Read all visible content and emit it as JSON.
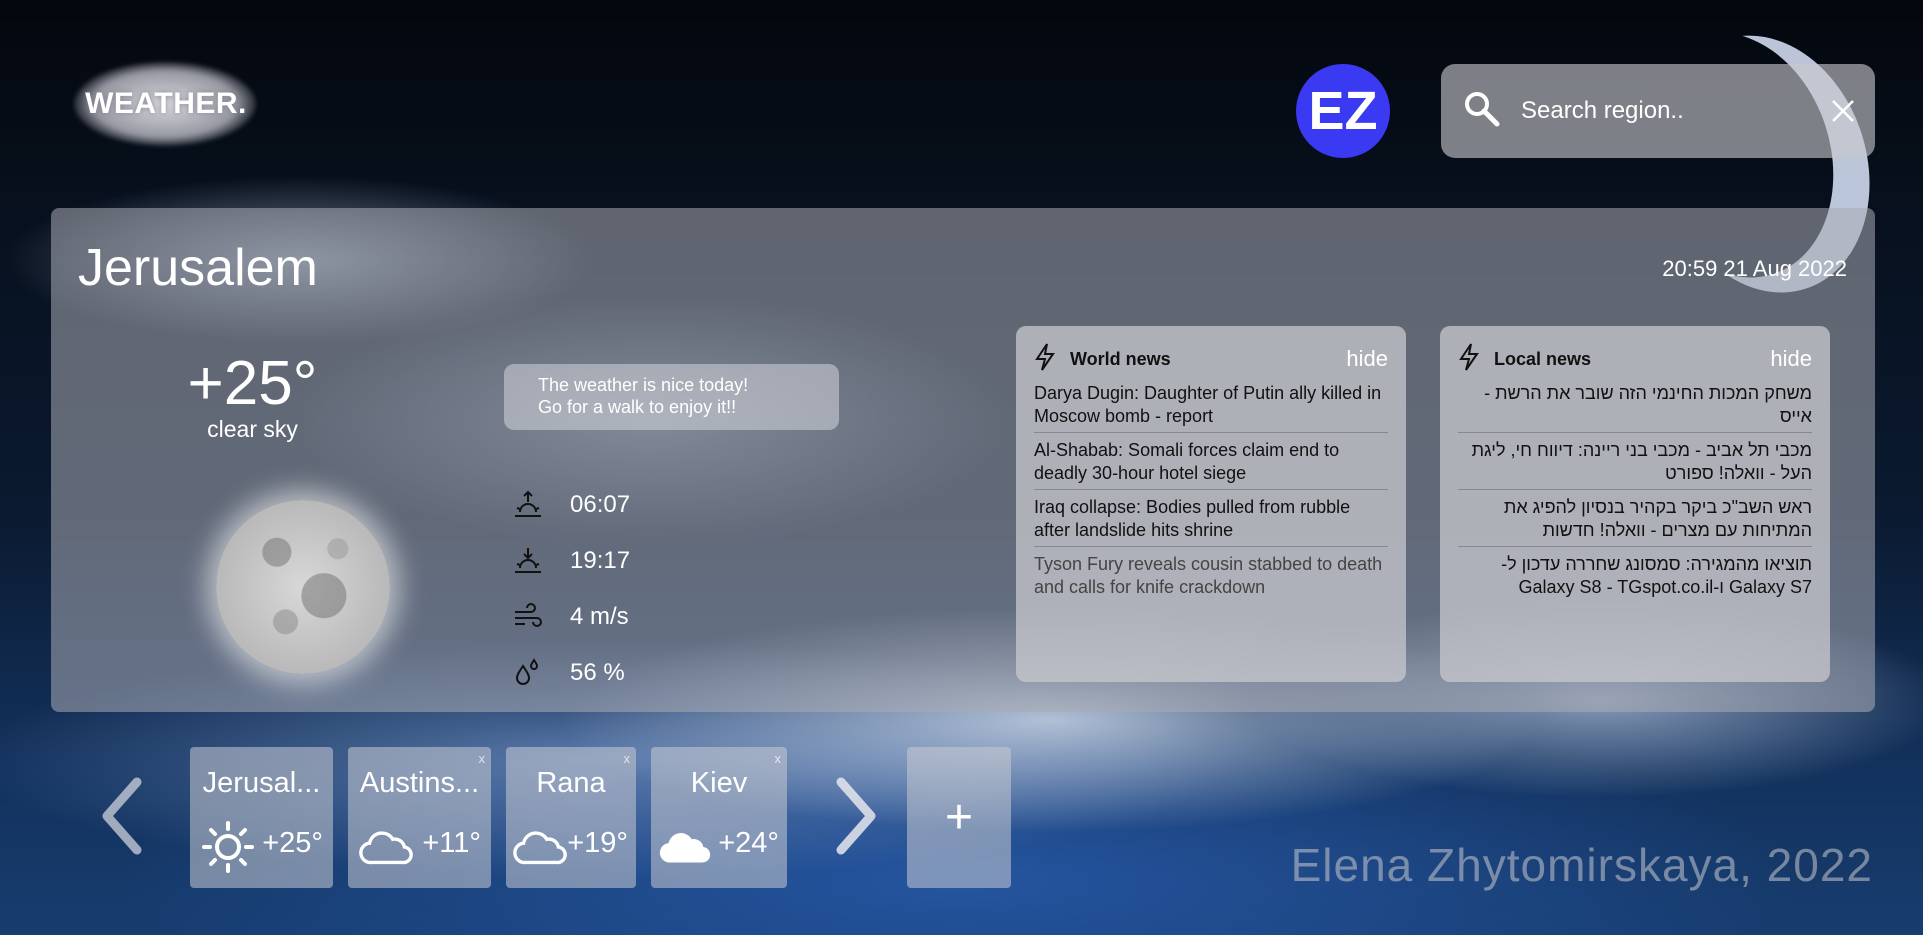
{
  "logo": {
    "text": "WEATHER."
  },
  "user": {
    "initials": "EZ",
    "avatar_color": "#3a3af2"
  },
  "search": {
    "placeholder": "Search region.."
  },
  "current": {
    "city": "Jerusalem",
    "datetime": "20:59 21 Aug 2022",
    "temperature": "+25°",
    "description": "clear sky",
    "tip_line1": "The weather is nice today!",
    "tip_line2": "Go for a walk to enjoy it!!",
    "sunrise": "06:07",
    "sunset": "19:17",
    "wind": "4 m/s",
    "humidity": "56 %"
  },
  "world_news": {
    "title": "World news",
    "hide_label": "hide",
    "items": [
      "Darya Dugin: Daughter of Putin ally killed in Moscow bomb - report",
      "Al-Shabab: Somali forces claim end to deadly 30-hour hotel siege",
      "Iraq collapse: Bodies pulled from rubble after landslide hits shrine",
      "Tyson Fury reveals cousin stabbed to death and calls for knife crackdown"
    ]
  },
  "local_news": {
    "title": "Local news",
    "hide_label": "hide",
    "items": [
      "משחק המכות החינמי הזה שובר את הרשת - אייס",
      "מכבי תל אביב - מכבי בני ריינה: דיווח חי, ליגת העל - וואלה! ספורט",
      "ראש השב\"כ ביקר בקהיר בנסיון להפיג את המתיחות עם מצרים - וואלה! חדשות",
      "תוציאו מהמגירה: סמסונג שחררה עדכון ל-Galaxy S7 ו-Galaxy S8 - TGspot.co.il"
    ]
  },
  "saved_locations": [
    {
      "name": "Jerusal...",
      "temp": "+25°",
      "icon": "sun-icon",
      "close": ""
    },
    {
      "name": "Austins...",
      "temp": "+11°",
      "icon": "cloud-outline-icon",
      "close": "x"
    },
    {
      "name": "Rana",
      "temp": "+19°",
      "icon": "cloud-outline-icon",
      "close": "x"
    },
    {
      "name": "Kiev",
      "temp": "+24°",
      "icon": "cloud-filled-icon",
      "close": "x"
    }
  ],
  "add_label": "+",
  "credit": "Elena Zhytomirskaya, 2022"
}
